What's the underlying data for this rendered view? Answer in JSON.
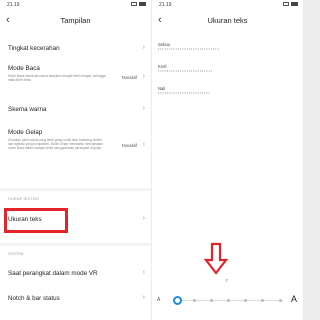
{
  "left": {
    "status": {
      "time": "21.19"
    },
    "title": "Tampilan",
    "items": [
      {
        "label": "Tingkat kecerahan"
      },
      {
        "label": "Mode Baca",
        "desc": "Mode Baca membuat warna tampilan menjadi lebih hangat, sehingga mata lebih rileks",
        "value": "Nonaktif"
      },
      {
        "label": "Skema warna"
      },
      {
        "label": "Mode Gelap",
        "desc": "Gunakan palet warna yang lebih gelap untuk latar belakang sistem dan aplikasi yang kompatibel. Mode Gelap membantu menciptakan mode Baca dalam sampai Anda menggunakan perangkat di gelap",
        "value": "Nonaktif"
      }
    ],
    "section_font": "HURUF SISTEM",
    "text_size_item": "Ukuran teks",
    "section_system": "SISTEM",
    "vr_item": "Saat perangkat dalam mode VR",
    "notch_item": "Notch & bar status"
  },
  "right": {
    "status": {
      "time": "21.19"
    },
    "title": "Ukuran teks",
    "samples": [
      {
        "label": "Sebuo",
        "text": "• • • • • • • • • • • • • • • • • • • • • • • • • • • •"
      },
      {
        "label": "Kreil",
        "text": "• • • • • • • • • • • • • • • • • • • • • • • • •"
      },
      {
        "label": "Nali",
        "text": "• • • • • • • • • • • • • • • • • • • • • • • •"
      }
    ],
    "slider": {
      "small_a": "A",
      "large_a": "A",
      "level": 0,
      "steps": 7
    }
  },
  "colors": {
    "highlight": "#e3242b",
    "slider_accent": "#1e88e5"
  }
}
